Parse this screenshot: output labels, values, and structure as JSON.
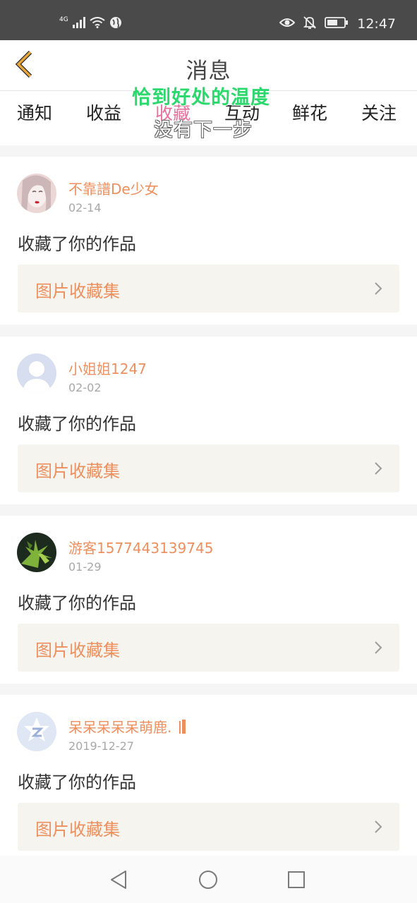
{
  "status_bar": {
    "network": "4G",
    "time": "12:47",
    "icons": [
      "signal-icon",
      "wifi-icon",
      "globe-icon",
      "eye-icon",
      "bell-off-icon",
      "battery-icon"
    ]
  },
  "header": {
    "title": "消息",
    "back_icon": "chevron-left-icon"
  },
  "tabs": [
    {
      "label": "通知",
      "active": false
    },
    {
      "label": "收益",
      "active": false
    },
    {
      "label": "收藏",
      "active": true
    },
    {
      "label": "互动",
      "active": false
    },
    {
      "label": "鲜花",
      "active": false
    },
    {
      "label": "关注",
      "active": false
    }
  ],
  "overlay": {
    "line1": "恰到好处的温度",
    "line2": "没有下一步"
  },
  "notifications": [
    {
      "username": "不靠譜De少女",
      "date": "02-14",
      "action": "收藏了你的作品",
      "collection": "图片收藏集"
    },
    {
      "username": "小姐姐1247",
      "date": "02-02",
      "action": "收藏了你的作品",
      "collection": "图片收藏集"
    },
    {
      "username": "游客1577443139745",
      "date": "01-29",
      "action": "收藏了你的作品",
      "collection": "图片收藏集"
    },
    {
      "username": "呆呆呆呆呆萌鹿.",
      "date": "2019-12-27",
      "action": "收藏了你的作品",
      "collection": "图片收藏集"
    }
  ],
  "colors": {
    "accent": "#ee8f5e",
    "active_tab": "#e8709b",
    "back_arrow": "#e8a63a",
    "collection_bg": "#f5f4ee"
  },
  "navbar": {
    "buttons": [
      "back-triangle-icon",
      "home-circle-icon",
      "recents-square-icon"
    ]
  }
}
